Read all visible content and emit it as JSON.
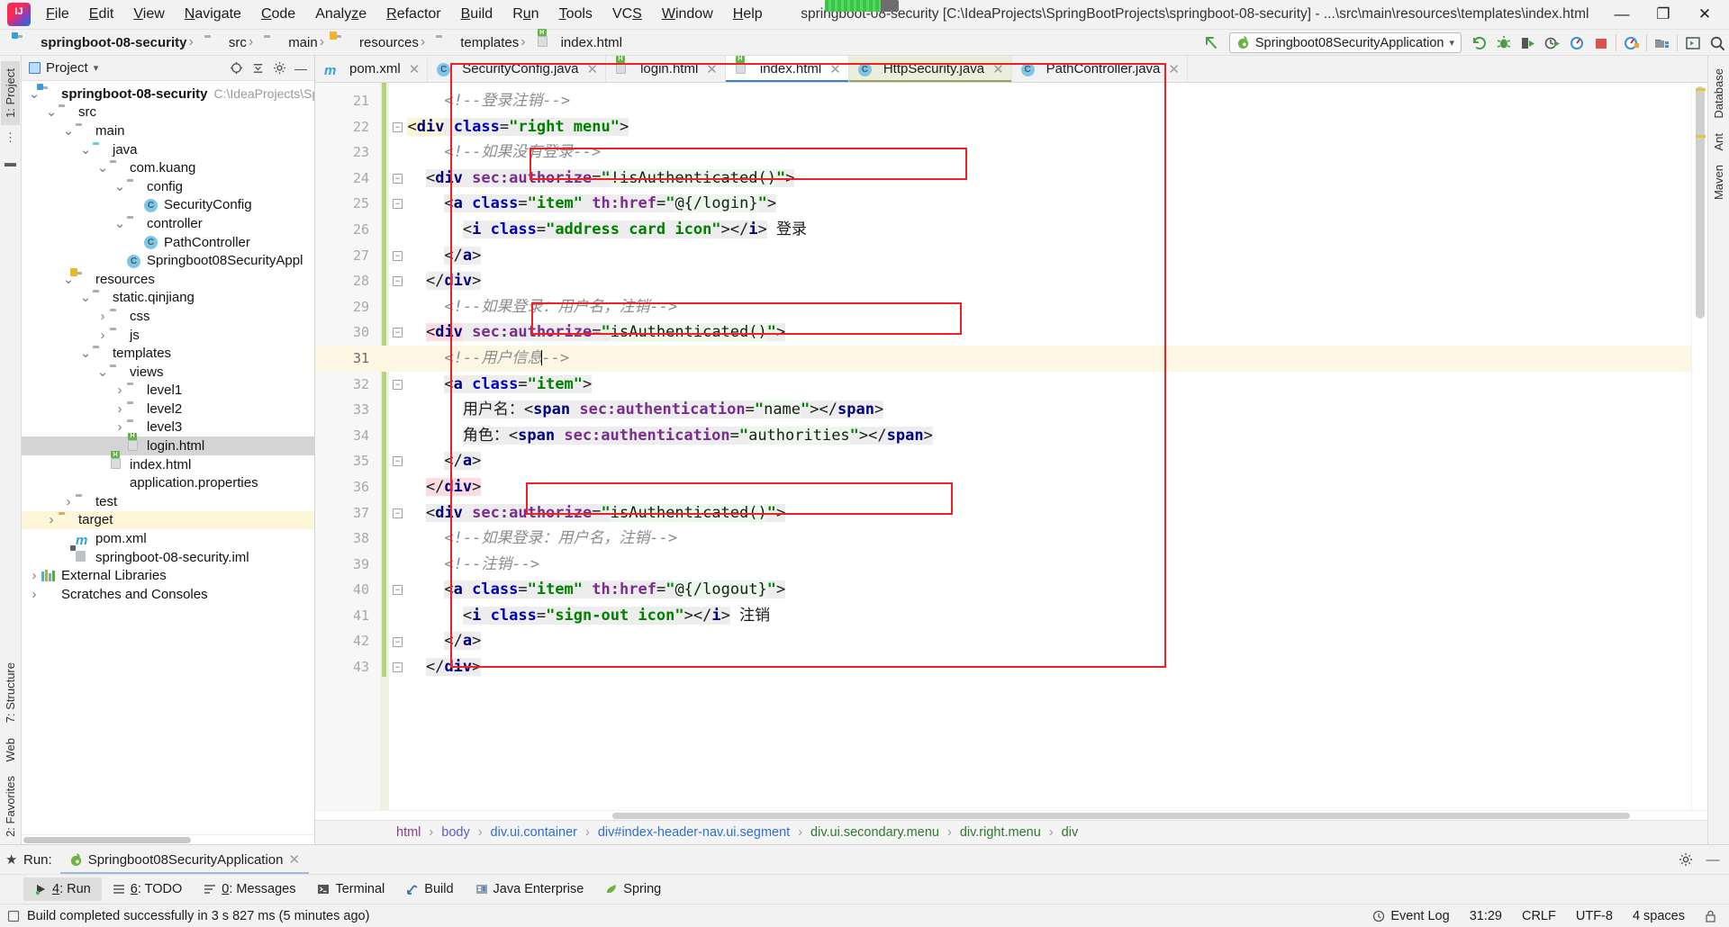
{
  "window": {
    "title": "springboot-08-security [C:\\IdeaProjects\\SpringBootProjects\\springboot-08-security] - ...\\src\\main\\resources\\templates\\index.html",
    "minimize": "—",
    "maximize": "❐",
    "close": "✕",
    "app_icon": "intellij-idea-logo"
  },
  "menu": [
    {
      "label": "File"
    },
    {
      "label": "Edit"
    },
    {
      "label": "View"
    },
    {
      "label": "Navigate"
    },
    {
      "label": "Code"
    },
    {
      "label": "Analyze"
    },
    {
      "label": "Refactor"
    },
    {
      "label": "Build"
    },
    {
      "label": "Run"
    },
    {
      "label": "Tools"
    },
    {
      "label": "VCS"
    },
    {
      "label": "Window"
    },
    {
      "label": "Help"
    }
  ],
  "navbar": {
    "crumbs": [
      {
        "label": "springboot-08-security",
        "icon": "module-folder-icon",
        "bold": true
      },
      {
        "label": "src",
        "icon": "folder-icon",
        "bold": false
      },
      {
        "label": "main",
        "icon": "folder-icon",
        "bold": false
      },
      {
        "label": "resources",
        "icon": "resources-folder-icon",
        "bold": false
      },
      {
        "label": "templates",
        "icon": "folder-icon",
        "bold": false
      },
      {
        "label": "index.html",
        "icon": "html-file-icon",
        "bold": false
      }
    ],
    "run_config": "Springboot08SecurityApplication",
    "run_config_icon": "spring-boot-icon",
    "dropdown_icon": "chevron-down-icon",
    "toolbar_icons": [
      "rerun-icon",
      "debug-icon",
      "coverage-icon",
      "profiler-icon",
      "run-dashboard-icon",
      "stop-icon",
      "update-running-app-icon",
      "project-structure-icon",
      "open-console-icon",
      "search-everywhere-icon"
    ]
  },
  "left_strip": {
    "tabs": [
      {
        "label": "1: Project",
        "active": true
      },
      {
        "label": "7: Structure",
        "active": false
      },
      {
        "label": "Web",
        "active": false
      },
      {
        "label": "2: Favorites",
        "active": false
      }
    ]
  },
  "right_strip": {
    "tabs": [
      {
        "label": "Database"
      },
      {
        "label": "Ant"
      },
      {
        "label": "Maven"
      }
    ]
  },
  "project_panel": {
    "title": "Project",
    "title_icon": "project-view-icon",
    "dropdown_icon": "chevron-down-icon",
    "header_icons": [
      "locate-icon",
      "collapse-all-icon",
      "settings-icon",
      "hide-icon"
    ],
    "tree": [
      {
        "depth": 0,
        "arrow": "∨",
        "icon": "module-folder-icon",
        "label": "springboot-08-security",
        "path": "C:\\IdeaProjects\\Spri",
        "bold": true,
        "state": ""
      },
      {
        "depth": 1,
        "arrow": "∨",
        "icon": "folder-icon",
        "label": "src",
        "path": "",
        "bold": false,
        "state": ""
      },
      {
        "depth": 2,
        "arrow": "∨",
        "icon": "folder-icon",
        "label": "main",
        "path": "",
        "bold": false,
        "state": ""
      },
      {
        "depth": 3,
        "arrow": "∨",
        "icon": "source-folder-icon",
        "label": "java",
        "path": "",
        "bold": false,
        "state": ""
      },
      {
        "depth": 4,
        "arrow": "∨",
        "icon": "package-icon",
        "label": "com.kuang",
        "path": "",
        "bold": false,
        "state": ""
      },
      {
        "depth": 5,
        "arrow": "∨",
        "icon": "package-icon",
        "label": "config",
        "path": "",
        "bold": false,
        "state": ""
      },
      {
        "depth": 6,
        "arrow": "",
        "icon": "java-class-icon",
        "label": "SecurityConfig",
        "path": "",
        "bold": false,
        "state": ""
      },
      {
        "depth": 5,
        "arrow": "∨",
        "icon": "package-icon",
        "label": "controller",
        "path": "",
        "bold": false,
        "state": ""
      },
      {
        "depth": 6,
        "arrow": "",
        "icon": "java-class-icon",
        "label": "PathController",
        "path": "",
        "bold": false,
        "state": ""
      },
      {
        "depth": 5,
        "arrow": "",
        "icon": "spring-boot-class-icon",
        "label": "Springboot08SecurityAppl",
        "path": "",
        "bold": false,
        "state": ""
      },
      {
        "depth": 2,
        "arrow": "∨",
        "icon": "resources-folder-icon",
        "label": "resources",
        "path": "",
        "bold": false,
        "state": ""
      },
      {
        "depth": 3,
        "arrow": "∨",
        "icon": "folder-icon",
        "label": "static.qinjiang",
        "path": "",
        "bold": false,
        "state": ""
      },
      {
        "depth": 4,
        "arrow": "›",
        "icon": "folder-icon",
        "label": "css",
        "path": "",
        "bold": false,
        "state": ""
      },
      {
        "depth": 4,
        "arrow": "›",
        "icon": "folder-icon",
        "label": "js",
        "path": "",
        "bold": false,
        "state": ""
      },
      {
        "depth": 3,
        "arrow": "∨",
        "icon": "folder-icon",
        "label": "templates",
        "path": "",
        "bold": false,
        "state": ""
      },
      {
        "depth": 4,
        "arrow": "∨",
        "icon": "folder-icon",
        "label": "views",
        "path": "",
        "bold": false,
        "state": ""
      },
      {
        "depth": 5,
        "arrow": "›",
        "icon": "folder-icon",
        "label": "level1",
        "path": "",
        "bold": false,
        "state": ""
      },
      {
        "depth": 5,
        "arrow": "›",
        "icon": "folder-icon",
        "label": "level2",
        "path": "",
        "bold": false,
        "state": ""
      },
      {
        "depth": 5,
        "arrow": "›",
        "icon": "folder-icon",
        "label": "level3",
        "path": "",
        "bold": false,
        "state": ""
      },
      {
        "depth": 5,
        "arrow": "",
        "icon": "html-file-icon",
        "label": "login.html",
        "path": "",
        "bold": false,
        "state": "sel"
      },
      {
        "depth": 4,
        "arrow": "",
        "icon": "html-file-icon",
        "label": "index.html",
        "path": "",
        "bold": false,
        "state": ""
      },
      {
        "depth": 4,
        "arrow": "",
        "icon": "properties-file-icon",
        "label": "application.properties",
        "path": "",
        "bold": false,
        "state": ""
      },
      {
        "depth": 2,
        "arrow": "›",
        "icon": "folder-icon",
        "label": "test",
        "path": "",
        "bold": false,
        "state": ""
      },
      {
        "depth": 1,
        "arrow": "›",
        "icon": "target-folder-icon",
        "label": "target",
        "path": "",
        "bold": false,
        "state": "hl"
      },
      {
        "depth": 2,
        "arrow": "",
        "icon": "maven-icon",
        "label": "pom.xml",
        "path": "",
        "bold": false,
        "state": ""
      },
      {
        "depth": 2,
        "arrow": "",
        "icon": "iml-file-icon",
        "label": "springboot-08-security.iml",
        "path": "",
        "bold": false,
        "state": ""
      },
      {
        "depth": 0,
        "arrow": "›",
        "icon": "libraries-icon",
        "label": "External Libraries",
        "path": "",
        "bold": false,
        "state": ""
      },
      {
        "depth": 0,
        "arrow": "›",
        "icon": "scratches-icon",
        "label": "Scratches and Consoles",
        "path": "",
        "bold": false,
        "state": ""
      }
    ]
  },
  "editor_tabs": [
    {
      "label": "pom.xml",
      "icon": "maven-icon",
      "state": ""
    },
    {
      "label": "SecurityConfig.java",
      "icon": "java-class-icon",
      "state": ""
    },
    {
      "label": "login.html",
      "icon": "html-file-icon",
      "state": ""
    },
    {
      "label": "index.html",
      "icon": "html-file-icon",
      "state": "active"
    },
    {
      "label": "HttpSecurity.java",
      "icon": "java-class-icon",
      "state": "focus"
    },
    {
      "label": "PathController.java",
      "icon": "java-class-icon",
      "state": ""
    }
  ],
  "editor": {
    "first_line_number": 21,
    "lines": [
      {
        "n": 21,
        "cur": false,
        "fold": "",
        "html": "      <span class=\"tok-cmt\">&lt;!--登录注销--&gt;</span>"
      },
      {
        "n": 22,
        "cur": false,
        "fold": "sq",
        "html": "  <span class=\"hlyel\"><span class=\"tok-punc\">&lt;</span><span class=\"tok-tag\">div</span></span><span class=\"hlbg\"> <span class=\"tok-attr2\">class</span><span class=\"tok-punc\">=</span><span class=\"tok-val\">\"right menu\"</span><span class=\"tok-punc\">&gt;</span></span>"
      },
      {
        "n": 23,
        "cur": false,
        "fold": "",
        "html": "      <span class=\"tok-cmt\">&lt;!--如果没有登录--&gt;</span>"
      },
      {
        "n": 24,
        "cur": false,
        "fold": "sq",
        "html": "    <span class=\"hlbg\"><span class=\"tok-punc\">&lt;</span><span class=\"tok-tag\">div</span> <span class=\"tok-attr\">sec:authorize</span><span class=\"tok-punc\">=</span><span class=\"tok-val\">\"</span></span><span class=\"hlgreen tok-val2\">!isAuthenticated()</span><span class=\"hlbg\"><span class=\"tok-val\">\"</span><span class=\"tok-punc\">&gt;</span></span>"
      },
      {
        "n": 25,
        "cur": false,
        "fold": "sq",
        "html": "      <span class=\"hlbg\"><span class=\"tok-punc\">&lt;</span><span class=\"tok-tag\">a</span> <span class=\"tok-attr2\">class</span><span class=\"tok-punc\">=</span><span class=\"tok-val\">\"item\"</span> <span class=\"tok-attr\">th:href</span><span class=\"tok-punc\">=</span><span class=\"tok-val\">\"</span></span><span class=\"hlgreen tok-val2\">@{/login}</span><span class=\"hlbg\"><span class=\"tok-val\">\"</span><span class=\"tok-punc\">&gt;</span></span>"
      },
      {
        "n": 26,
        "cur": false,
        "fold": "",
        "html": "        <span class=\"hlbg\"><span class=\"tok-punc\">&lt;</span><span class=\"tok-tag\">i</span> <span class=\"tok-attr2\">class</span><span class=\"tok-punc\">=</span><span class=\"tok-val\">\"address card icon\"</span><span class=\"tok-punc\">&gt;&lt;/</span><span class=\"tok-tag\">i</span><span class=\"tok-punc\">&gt;</span></span> <span class=\"tok-txt\">登录</span>"
      },
      {
        "n": 27,
        "cur": false,
        "fold": "sq",
        "html": "      <span class=\"hlbg\"><span class=\"tok-punc\">&lt;/</span><span class=\"tok-tag\">a</span><span class=\"tok-punc\">&gt;</span></span>"
      },
      {
        "n": 28,
        "cur": false,
        "fold": "sq",
        "html": "    <span class=\"hlbg\"><span class=\"tok-punc\">&lt;/</span><span class=\"tok-tag\">div</span><span class=\"tok-punc\">&gt;</span></span>"
      },
      {
        "n": 29,
        "cur": false,
        "fold": "",
        "html": "      <span class=\"tok-cmt\">&lt;!--如果登录：用户名，注销--&gt;</span>"
      },
      {
        "n": 30,
        "cur": false,
        "fold": "sq",
        "html": "    <span class=\"hlpink\"><span class=\"tok-punc\">&lt;</span><span class=\"tok-tag\">div</span></span><span class=\"hlbg\"> <span class=\"tok-attr\">sec:authorize</span><span class=\"tok-punc\">=</span><span class=\"tok-val\">\"</span></span><span class=\"hlgreen tok-val2\">isAuthenticated()</span><span class=\"hlbg\"><span class=\"tok-val\">\"</span><span class=\"tok-punc\">&gt;</span></span>"
      },
      {
        "n": 31,
        "cur": true,
        "fold": "",
        "html": "      <span class=\"tok-cmt\">&lt;!--用户信息</span><span class=\"caret\"></span><span class=\"tok-cmt\">--&gt;</span>"
      },
      {
        "n": 32,
        "cur": false,
        "fold": "sq",
        "html": "      <span class=\"hlbg\"><span class=\"tok-punc\">&lt;</span><span class=\"tok-tag\">a</span> <span class=\"tok-attr2\">class</span><span class=\"tok-punc\">=</span><span class=\"tok-val\">\"item\"</span><span class=\"tok-punc\">&gt;</span></span>"
      },
      {
        "n": 33,
        "cur": false,
        "fold": "",
        "html": "        <span class=\"hlbg tok-txt\">用户名：</span><span class=\"hlbg\"><span class=\"tok-punc\">&lt;</span><span class=\"tok-tag\">span</span> <span class=\"tok-attr\">sec:authentication</span><span class=\"tok-punc\">=</span><span class=\"tok-val\">\"</span></span><span class=\"hlgreen tok-val2\">name</span><span class=\"hlbg\"><span class=\"tok-val\">\"</span><span class=\"tok-punc\">&gt;&lt;/</span><span class=\"tok-tag\">span</span><span class=\"tok-punc\">&gt;</span></span>"
      },
      {
        "n": 34,
        "cur": false,
        "fold": "",
        "html": "        <span class=\"hlbg tok-txt\">角色：</span><span class=\"hlbg\"><span class=\"tok-punc\">&lt;</span><span class=\"tok-tag\">span</span> <span class=\"tok-attr\">sec:authentication</span><span class=\"tok-punc\">=</span><span class=\"tok-val\">\"</span></span><span class=\"hlgreen tok-val2\">authorities</span><span class=\"hlbg\"><span class=\"tok-val\">\"</span><span class=\"tok-punc\">&gt;&lt;/</span><span class=\"tok-tag\">span</span><span class=\"tok-punc\">&gt;</span></span>"
      },
      {
        "n": 35,
        "cur": false,
        "fold": "sq",
        "html": "      <span class=\"hlbg\"><span class=\"tok-punc\">&lt;/</span><span class=\"tok-tag\">a</span><span class=\"tok-punc\">&gt;</span></span>"
      },
      {
        "n": 36,
        "cur": false,
        "fold": "",
        "html": "    <span class=\"hlpink\"><span class=\"tok-punc\">&lt;/</span><span class=\"tok-tag\">div</span><span class=\"tok-punc\">&gt;</span></span>"
      },
      {
        "n": 37,
        "cur": false,
        "fold": "sq",
        "html": "    <span class=\"hlbg\"><span class=\"tok-punc\">&lt;</span><span class=\"tok-tag\">div</span> <span class=\"tok-attr\">sec:authorize</span><span class=\"tok-punc\">=</span><span class=\"tok-val\">\"</span></span><span class=\"hlgreen tok-val2\">isAuthenticated()</span><span class=\"hlbg\"><span class=\"tok-val\">\"</span><span class=\"tok-punc\">&gt;</span></span>"
      },
      {
        "n": 38,
        "cur": false,
        "fold": "",
        "html": "      <span class=\"tok-cmt\">&lt;!--如果登录：用户名，注销--&gt;</span>"
      },
      {
        "n": 39,
        "cur": false,
        "fold": "",
        "html": "      <span class=\"tok-cmt\">&lt;!--注销--&gt;</span>"
      },
      {
        "n": 40,
        "cur": false,
        "fold": "sq",
        "html": "      <span class=\"hlbg\"><span class=\"tok-punc\">&lt;</span><span class=\"tok-tag\">a</span> <span class=\"tok-attr2\">class</span><span class=\"tok-punc\">=</span><span class=\"tok-val\">\"item\"</span> <span class=\"tok-attr\">th:href</span><span class=\"tok-punc\">=</span><span class=\"tok-val\">\"</span></span><span class=\"hlgreen tok-val2\">@{/logout}</span><span class=\"hlbg\"><span class=\"tok-val\">\"</span><span class=\"tok-punc\">&gt;</span></span>"
      },
      {
        "n": 41,
        "cur": false,
        "fold": "",
        "html": "        <span class=\"hlbg\"><span class=\"tok-punc\">&lt;</span><span class=\"tok-tag\">i</span> <span class=\"tok-attr2\">class</span><span class=\"tok-punc\">=</span><span class=\"tok-val\">\"sign-out icon\"</span><span class=\"tok-punc\">&gt;&lt;/</span><span class=\"tok-tag\">i</span><span class=\"tok-punc\">&gt;</span></span> <span class=\"tok-txt\">注销</span>"
      },
      {
        "n": 42,
        "cur": false,
        "fold": "sq",
        "html": "      <span class=\"hlbg\"><span class=\"tok-punc\">&lt;/</span><span class=\"tok-tag\">a</span><span class=\"tok-punc\">&gt;</span></span>"
      },
      {
        "n": 43,
        "cur": false,
        "fold": "sq",
        "html": "    <span class=\"hlbg\"><span class=\"tok-punc\">&lt;/</span><span class=\"tok-tag\">div</span><span class=\"tok-punc\">&gt;</span></span>"
      }
    ],
    "annotations": {
      "red_outline_color": "#ee2222",
      "boxes": [
        "outer-selection-box",
        "line-24-highlight",
        "line-30-highlight",
        "line-37-highlight"
      ]
    }
  },
  "breadcrumb_bar": [
    {
      "label": "html"
    },
    {
      "label": "body"
    },
    {
      "label": "div.ui.container"
    },
    {
      "label": "div#index-header-nav.ui.segment"
    },
    {
      "label": "div.ui.secondary.menu"
    },
    {
      "label": "div.right.menu"
    },
    {
      "label": "div"
    }
  ],
  "run_panel": {
    "label": "Run:",
    "tab": "Springboot08SecurityApplication",
    "tab_icon": "spring-boot-icon",
    "close_icon": "close-icon",
    "header_icons": [
      "settings-icon",
      "hide-icon"
    ],
    "tools": [
      {
        "label": "4: Run",
        "icon": "run-icon",
        "active": true
      },
      {
        "label": "6: TODO",
        "icon": "todo-icon",
        "active": false
      },
      {
        "label": "0: Messages",
        "icon": "messages-icon",
        "active": false
      },
      {
        "label": "Terminal",
        "icon": "terminal-icon",
        "active": false
      },
      {
        "label": "Build",
        "icon": "build-icon",
        "active": false
      },
      {
        "label": "Java Enterprise",
        "icon": "java-enterprise-icon",
        "active": false
      },
      {
        "label": "Spring",
        "icon": "spring-icon",
        "active": false
      }
    ]
  },
  "status_bar": {
    "message": "Build completed successfully in 3 s 827 ms (5 minutes ago)",
    "message_icon": "build-status-icon",
    "event_log": "Event Log",
    "event_log_icon": "event-log-icon",
    "caret_position": "31:29",
    "line_separator": "CRLF",
    "encoding": "UTF-8",
    "indent": "4 spaces"
  },
  "colors": {
    "accent_blue": "#3b7fd4",
    "annotation_red": "#ee2222",
    "highlight_yellow": "#fdf6e3",
    "tab_focus": "#eceedd"
  }
}
